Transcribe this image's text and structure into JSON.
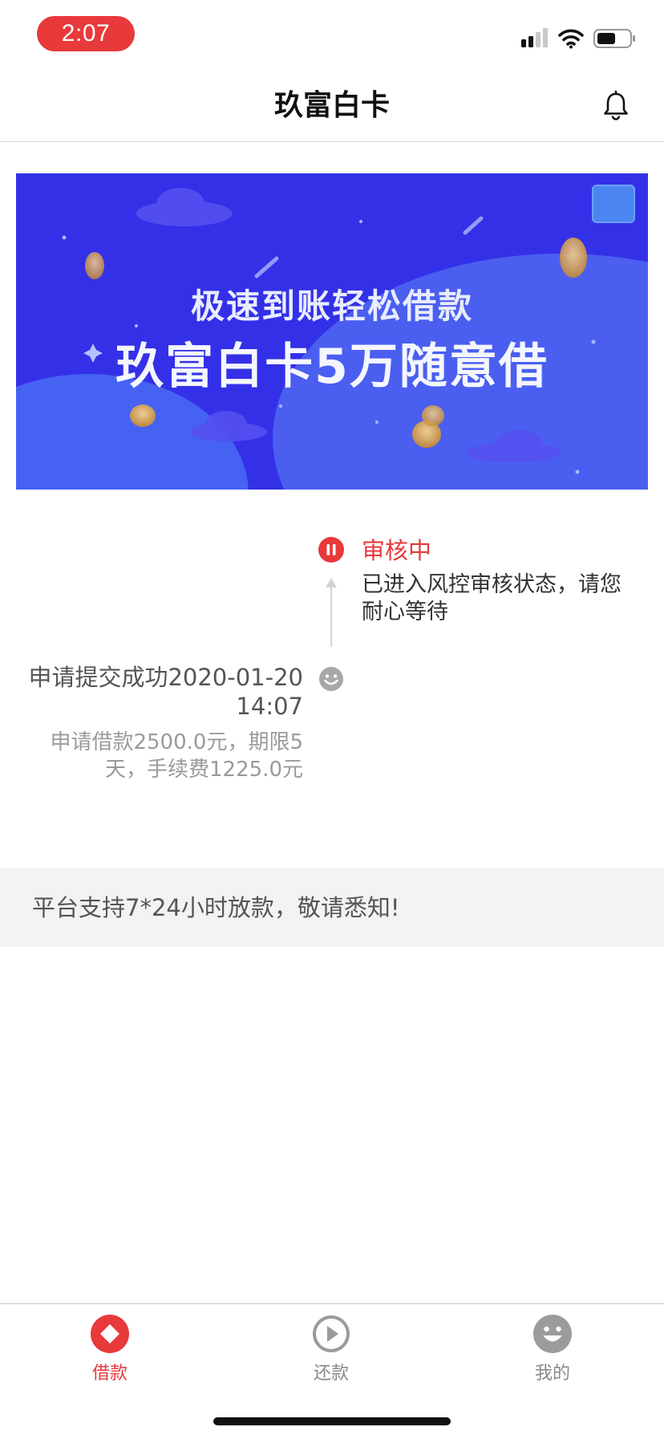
{
  "status_bar": {
    "time": "2:07",
    "time_pill_color": "#e8393b"
  },
  "header": {
    "title": "玖富白卡",
    "bell_icon": "bell-icon"
  },
  "banner": {
    "line1": "极速到账轻松借款",
    "line2": "玖富白卡5万随意借",
    "background": "#3430e8"
  },
  "timeline": {
    "review": {
      "title": "审核中",
      "description": "已进入风控审核状态，请您耐心等待",
      "icon": "pause-icon",
      "color": "#e8393b"
    },
    "submit": {
      "title": "申请提交成功2020-01-20 14:07",
      "description": "申请借款2500.0元，期限5天，手续费1225.0元",
      "icon": "smile-icon"
    }
  },
  "notice": {
    "text": "平台支持7*24小时放款，敬请悉知!"
  },
  "tabs": [
    {
      "label": "借款",
      "icon": "diamond-icon",
      "active": true
    },
    {
      "label": "还款",
      "icon": "play-icon",
      "active": false
    },
    {
      "label": "我的",
      "icon": "smile-icon",
      "active": false
    }
  ],
  "colors": {
    "accent": "#e8393b",
    "inactive": "#9b9b9b"
  }
}
